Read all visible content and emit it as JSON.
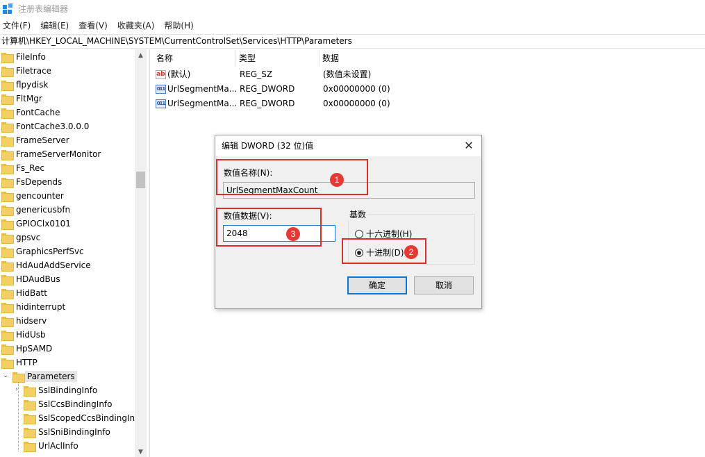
{
  "window": {
    "title": "注册表编辑器"
  },
  "menu": [
    "文件(F)",
    "编辑(E)",
    "查看(V)",
    "收藏夹(A)",
    "帮助(H)"
  ],
  "address": "计算机\\HKEY_LOCAL_MACHINE\\SYSTEM\\CurrentControlSet\\Services\\HTTP\\Parameters",
  "tree": {
    "items": [
      "FileInfo",
      "Filetrace",
      "flpydisk",
      "FltMgr",
      "FontCache",
      "FontCache3.0.0.0",
      "FrameServer",
      "FrameServerMonitor",
      "Fs_Rec",
      "FsDepends",
      "gencounter",
      "genericusbfn",
      "GPIOClx0101",
      "gpsvc",
      "GraphicsPerfSvc",
      "HdAudAddService",
      "HDAudBus",
      "HidBatt",
      "hidinterrupt",
      "hidserv",
      "HidUsb",
      "HpSAMD",
      "HTTP"
    ],
    "selected": "Parameters",
    "children": [
      "SslBindingInfo",
      "SslCcsBindingInfo",
      "SslScopedCcsBindingInf",
      "SslSniBindingInfo",
      "UrlAclInfo"
    ]
  },
  "list": {
    "headers": {
      "name": "名称",
      "type": "类型",
      "data": "数据"
    },
    "rows": [
      {
        "icon": "string-value-icon",
        "name": "(默认)",
        "type": "REG_SZ",
        "data": "(数值未设置)"
      },
      {
        "icon": "binary-value-icon",
        "name": "UrlSegmentMa...",
        "type": "REG_DWORD",
        "data": "0x00000000 (0)"
      },
      {
        "icon": "binary-value-icon",
        "name": "UrlSegmentMa...",
        "type": "REG_DWORD",
        "data": "0x00000000 (0)"
      }
    ]
  },
  "dialog": {
    "title": "编辑 DWORD (32 位)值",
    "name_label": "数值名称(N):",
    "name_value": "UrlSegmentMaxCount",
    "data_label": "数值数据(V):",
    "data_value": "2048",
    "base_label": "基数",
    "hex_label": "十六进制(H)",
    "dec_label": "十进制(D)",
    "selected_base": "decimal",
    "ok": "确定",
    "cancel": "取消"
  },
  "annotations": [
    "1",
    "2",
    "3"
  ],
  "colors": {
    "annotation": "#e53935",
    "accent": "#0078d7",
    "folder": "#f5cf64"
  }
}
